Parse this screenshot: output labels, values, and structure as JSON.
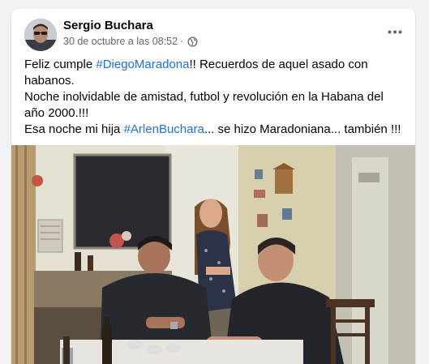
{
  "post": {
    "author": "Sergio Buchara",
    "timestamp": "30 de octubre a las 08:52",
    "separator": "·",
    "audience_icon": "globe-icon",
    "more_icon": "more-options-icon",
    "text": {
      "l1_a": "Feliz cumple ",
      "l1_tag": "#DiegoMaradona",
      "l1_b": "!! Recuerdos de aquel asado con",
      "l2": "habanos.",
      "l3": "Noche inolvidable de amistad,  futbol y revolución en la Habana del",
      "l4": "año 2000.!!!",
      "l5_a": "Esa noche  mi hija ",
      "l5_tag": "#ArlenBuchara",
      "l5_b": "... se hizo Maradoniana... también !!!"
    },
    "photo": {
      "icon": "photo-image",
      "description_colors": {
        "wall": "#cfc8b2",
        "shirt": "#26292e",
        "shadow": "#3c3a36"
      }
    }
  },
  "colors": {
    "link": "#216fdb",
    "text": "#050505",
    "muted": "#65676b",
    "background": "#f0f2f5"
  }
}
